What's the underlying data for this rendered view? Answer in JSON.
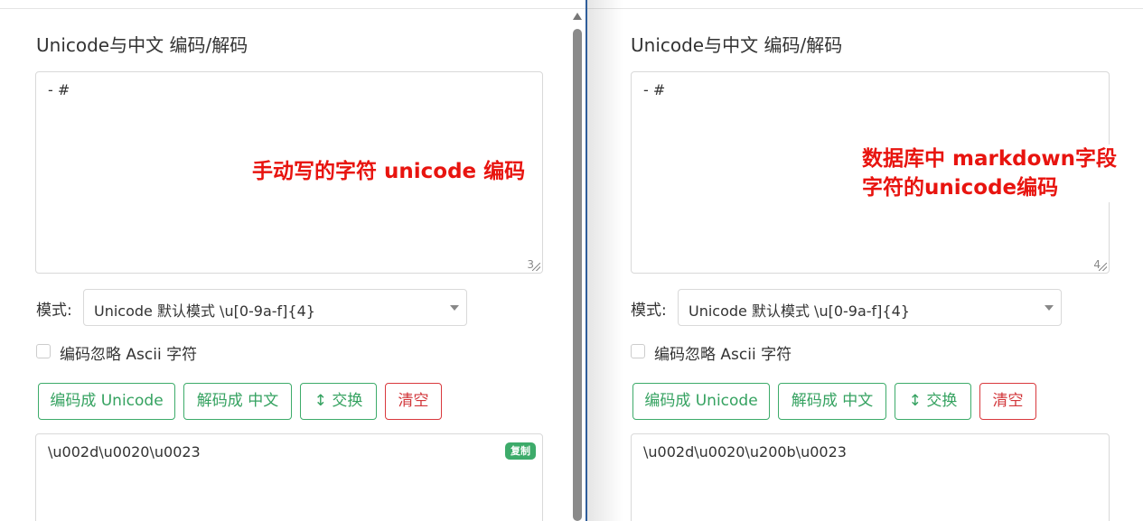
{
  "left": {
    "title": "Unicode与中文 编码/解码",
    "input_text": "- #",
    "input_counter": "3",
    "annotation": "手动写的字符 unicode 编码",
    "mode_label": "模式:",
    "mode_value": "Unicode 默认模式 \\u[0-9a-f]{4}",
    "ignore_ascii_label": "编码忽略 Ascii 字符",
    "buttons": {
      "encode": "编码成 Unicode",
      "decode": "解码成 中文",
      "swap": "↕ 交换",
      "clear": "清空"
    },
    "output_text": "\\u002d\\u0020\\u0023",
    "copy_label": "复制"
  },
  "right": {
    "title": "Unicode与中文 编码/解码",
    "input_text": "- #",
    "input_counter": "4",
    "annotation_line1": "数据库中 markdown字段",
    "annotation_line2": "字符的unicode编码",
    "mode_label": "模式:",
    "mode_value": "Unicode 默认模式 \\u[0-9a-f]{4}",
    "ignore_ascii_label": "编码忽略 Ascii 字符",
    "buttons": {
      "encode": "编码成 Unicode",
      "decode": "解码成 中文",
      "swap": "↕ 交换",
      "clear": "清空"
    },
    "output_text": "\\u002d\\u0020\\u200b\\u0023"
  },
  "colors": {
    "accent_green": "#3dab6a",
    "danger_red": "#d9393d",
    "annotation_red": "#e8140f",
    "divider_blue": "#2f5d9a"
  }
}
